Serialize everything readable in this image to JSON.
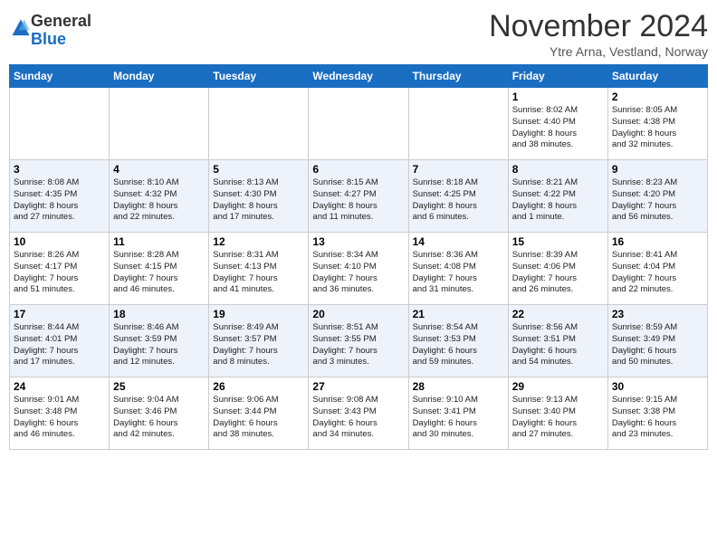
{
  "header": {
    "logo_general": "General",
    "logo_blue": "Blue",
    "month": "November 2024",
    "location": "Ytre Arna, Vestland, Norway"
  },
  "days_of_week": [
    "Sunday",
    "Monday",
    "Tuesday",
    "Wednesday",
    "Thursday",
    "Friday",
    "Saturday"
  ],
  "weeks": [
    [
      {
        "day": "",
        "info": ""
      },
      {
        "day": "",
        "info": ""
      },
      {
        "day": "",
        "info": ""
      },
      {
        "day": "",
        "info": ""
      },
      {
        "day": "",
        "info": ""
      },
      {
        "day": "1",
        "info": "Sunrise: 8:02 AM\nSunset: 4:40 PM\nDaylight: 8 hours\nand 38 minutes."
      },
      {
        "day": "2",
        "info": "Sunrise: 8:05 AM\nSunset: 4:38 PM\nDaylight: 8 hours\nand 32 minutes."
      }
    ],
    [
      {
        "day": "3",
        "info": "Sunrise: 8:08 AM\nSunset: 4:35 PM\nDaylight: 8 hours\nand 27 minutes."
      },
      {
        "day": "4",
        "info": "Sunrise: 8:10 AM\nSunset: 4:32 PM\nDaylight: 8 hours\nand 22 minutes."
      },
      {
        "day": "5",
        "info": "Sunrise: 8:13 AM\nSunset: 4:30 PM\nDaylight: 8 hours\nand 17 minutes."
      },
      {
        "day": "6",
        "info": "Sunrise: 8:15 AM\nSunset: 4:27 PM\nDaylight: 8 hours\nand 11 minutes."
      },
      {
        "day": "7",
        "info": "Sunrise: 8:18 AM\nSunset: 4:25 PM\nDaylight: 8 hours\nand 6 minutes."
      },
      {
        "day": "8",
        "info": "Sunrise: 8:21 AM\nSunset: 4:22 PM\nDaylight: 8 hours\nand 1 minute."
      },
      {
        "day": "9",
        "info": "Sunrise: 8:23 AM\nSunset: 4:20 PM\nDaylight: 7 hours\nand 56 minutes."
      }
    ],
    [
      {
        "day": "10",
        "info": "Sunrise: 8:26 AM\nSunset: 4:17 PM\nDaylight: 7 hours\nand 51 minutes."
      },
      {
        "day": "11",
        "info": "Sunrise: 8:28 AM\nSunset: 4:15 PM\nDaylight: 7 hours\nand 46 minutes."
      },
      {
        "day": "12",
        "info": "Sunrise: 8:31 AM\nSunset: 4:13 PM\nDaylight: 7 hours\nand 41 minutes."
      },
      {
        "day": "13",
        "info": "Sunrise: 8:34 AM\nSunset: 4:10 PM\nDaylight: 7 hours\nand 36 minutes."
      },
      {
        "day": "14",
        "info": "Sunrise: 8:36 AM\nSunset: 4:08 PM\nDaylight: 7 hours\nand 31 minutes."
      },
      {
        "day": "15",
        "info": "Sunrise: 8:39 AM\nSunset: 4:06 PM\nDaylight: 7 hours\nand 26 minutes."
      },
      {
        "day": "16",
        "info": "Sunrise: 8:41 AM\nSunset: 4:04 PM\nDaylight: 7 hours\nand 22 minutes."
      }
    ],
    [
      {
        "day": "17",
        "info": "Sunrise: 8:44 AM\nSunset: 4:01 PM\nDaylight: 7 hours\nand 17 minutes."
      },
      {
        "day": "18",
        "info": "Sunrise: 8:46 AM\nSunset: 3:59 PM\nDaylight: 7 hours\nand 12 minutes."
      },
      {
        "day": "19",
        "info": "Sunrise: 8:49 AM\nSunset: 3:57 PM\nDaylight: 7 hours\nand 8 minutes."
      },
      {
        "day": "20",
        "info": "Sunrise: 8:51 AM\nSunset: 3:55 PM\nDaylight: 7 hours\nand 3 minutes."
      },
      {
        "day": "21",
        "info": "Sunrise: 8:54 AM\nSunset: 3:53 PM\nDaylight: 6 hours\nand 59 minutes."
      },
      {
        "day": "22",
        "info": "Sunrise: 8:56 AM\nSunset: 3:51 PM\nDaylight: 6 hours\nand 54 minutes."
      },
      {
        "day": "23",
        "info": "Sunrise: 8:59 AM\nSunset: 3:49 PM\nDaylight: 6 hours\nand 50 minutes."
      }
    ],
    [
      {
        "day": "24",
        "info": "Sunrise: 9:01 AM\nSunset: 3:48 PM\nDaylight: 6 hours\nand 46 minutes."
      },
      {
        "day": "25",
        "info": "Sunrise: 9:04 AM\nSunset: 3:46 PM\nDaylight: 6 hours\nand 42 minutes."
      },
      {
        "day": "26",
        "info": "Sunrise: 9:06 AM\nSunset: 3:44 PM\nDaylight: 6 hours\nand 38 minutes."
      },
      {
        "day": "27",
        "info": "Sunrise: 9:08 AM\nSunset: 3:43 PM\nDaylight: 6 hours\nand 34 minutes."
      },
      {
        "day": "28",
        "info": "Sunrise: 9:10 AM\nSunset: 3:41 PM\nDaylight: 6 hours\nand 30 minutes."
      },
      {
        "day": "29",
        "info": "Sunrise: 9:13 AM\nSunset: 3:40 PM\nDaylight: 6 hours\nand 27 minutes."
      },
      {
        "day": "30",
        "info": "Sunrise: 9:15 AM\nSunset: 3:38 PM\nDaylight: 6 hours\nand 23 minutes."
      }
    ]
  ]
}
